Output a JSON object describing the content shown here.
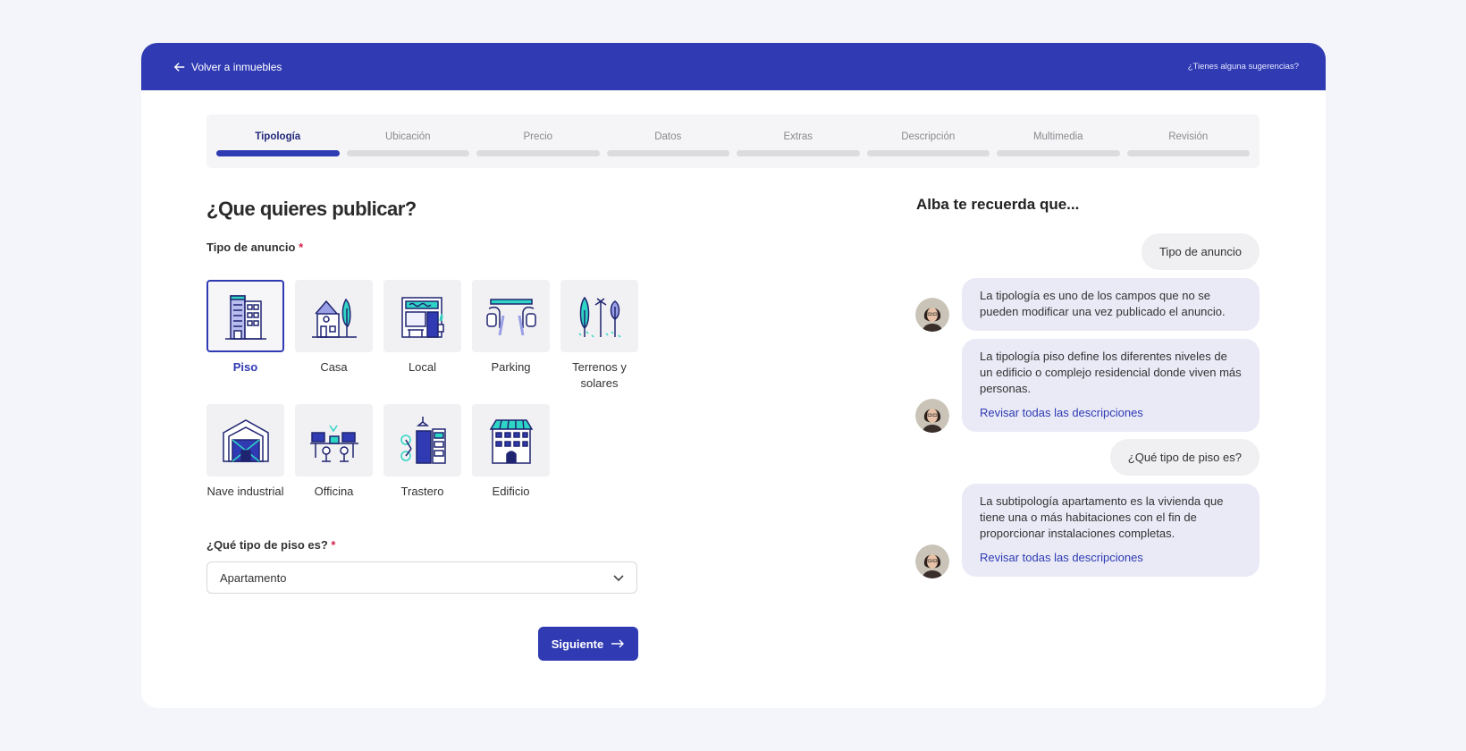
{
  "header": {
    "back_label": "Volver a inmuebles",
    "suggest_label": "¿Tienes alguna sugerencias?",
    "brand_color": "#2f3ab3"
  },
  "steps": [
    {
      "label": "Tipología",
      "active": true
    },
    {
      "label": "Ubicación",
      "active": false
    },
    {
      "label": "Precio",
      "active": false
    },
    {
      "label": "Datos",
      "active": false
    },
    {
      "label": "Extras",
      "active": false
    },
    {
      "label": "Descripción",
      "active": false
    },
    {
      "label": "Multimedia",
      "active": false
    },
    {
      "label": "Revisión",
      "active": false
    }
  ],
  "form": {
    "title": "¿Que quieres publicar?",
    "type_label": "Tipo de anuncio",
    "required_mark": "*",
    "types": [
      {
        "label": "Piso",
        "icon": "apartment-building-icon",
        "selected": true
      },
      {
        "label": "Casa",
        "icon": "house-icon",
        "selected": false
      },
      {
        "label": "Local",
        "icon": "storefront-icon",
        "selected": false
      },
      {
        "label": "Parking",
        "icon": "parking-icon",
        "selected": false
      },
      {
        "label": "Terrenos y solares",
        "icon": "land-trees-icon",
        "selected": false
      },
      {
        "label": "Nave industrial",
        "icon": "warehouse-icon",
        "selected": false
      },
      {
        "label": "Officina",
        "icon": "office-desk-icon",
        "selected": false
      },
      {
        "label": "Trastero",
        "icon": "storage-room-icon",
        "selected": false
      },
      {
        "label": "Edificio",
        "icon": "building-icon",
        "selected": false
      }
    ],
    "subtype_label": "¿Qué tipo de piso es?",
    "subtype_value": "Apartamento",
    "next_label": "Siguiente"
  },
  "assistant": {
    "title": "Alba te recuerda que...",
    "messages": [
      {
        "role": "user",
        "text": "Tipo de anuncio"
      },
      {
        "role": "bot",
        "text": "La tipología es uno de los campos que no se pueden modificar una vez publicado el anuncio."
      },
      {
        "role": "bot",
        "text": "La tipología piso define los diferentes niveles de un edificio o complejo residencial donde viven más personas.",
        "link": "Revisar todas las descripciones"
      },
      {
        "role": "user",
        "text": "¿Qué tipo de piso es?"
      },
      {
        "role": "bot",
        "text": "La subtipología apartamento es la vivienda que tiene una o más habitaciones con el fin de proporcionar instalaciones completas.",
        "link": "Revisar todas las descripciones"
      }
    ]
  },
  "colors": {
    "accent": "#2f3ab3",
    "teal": "#2fd5c4",
    "lavender": "#9aa0e6",
    "required": "#d3254a"
  }
}
